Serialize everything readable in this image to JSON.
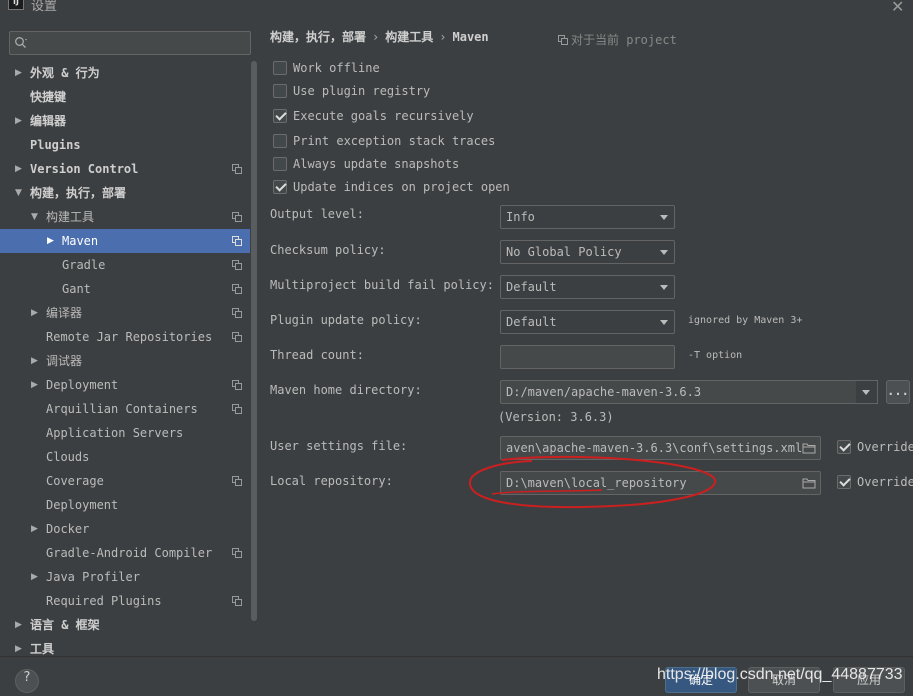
{
  "window": {
    "title": "设置",
    "app_icon_text": "IJ"
  },
  "sidebar": {
    "search": {
      "placeholder": "",
      "value": ""
    },
    "items": [
      {
        "label": "外观 & 行为",
        "arrow": "▶",
        "indent": 0,
        "bold": true,
        "copy": false,
        "selected": false
      },
      {
        "label": "快捷键",
        "arrow": "",
        "indent": 0,
        "bold": true,
        "copy": false,
        "selected": false
      },
      {
        "label": "编辑器",
        "arrow": "▶",
        "indent": 0,
        "bold": true,
        "copy": false,
        "selected": false
      },
      {
        "label": "Plugins",
        "arrow": "",
        "indent": 0,
        "bold": true,
        "copy": false,
        "selected": false
      },
      {
        "label": "Version Control",
        "arrow": "▶",
        "indent": 0,
        "bold": true,
        "copy": true,
        "selected": false
      },
      {
        "label": "构建，执行，部署",
        "arrow": "▼",
        "indent": 0,
        "bold": true,
        "copy": false,
        "selected": false
      },
      {
        "label": "构建工具",
        "arrow": "▼",
        "indent": 1,
        "bold": false,
        "copy": true,
        "selected": false
      },
      {
        "label": "Maven",
        "arrow": "▶",
        "indent": 2,
        "bold": false,
        "copy": true,
        "selected": true
      },
      {
        "label": "Gradle",
        "arrow": "",
        "indent": 2,
        "bold": false,
        "copy": true,
        "selected": false
      },
      {
        "label": "Gant",
        "arrow": "",
        "indent": 2,
        "bold": false,
        "copy": true,
        "selected": false
      },
      {
        "label": "编译器",
        "arrow": "▶",
        "indent": 1,
        "bold": false,
        "copy": true,
        "selected": false
      },
      {
        "label": "Remote Jar Repositories",
        "arrow": "",
        "indent": 1,
        "bold": false,
        "copy": true,
        "selected": false
      },
      {
        "label": "调试器",
        "arrow": "▶",
        "indent": 1,
        "bold": false,
        "copy": false,
        "selected": false
      },
      {
        "label": "Deployment",
        "arrow": "▶",
        "indent": 1,
        "bold": false,
        "copy": true,
        "selected": false
      },
      {
        "label": "Arquillian Containers",
        "arrow": "",
        "indent": 1,
        "bold": false,
        "copy": true,
        "selected": false
      },
      {
        "label": "Application Servers",
        "arrow": "",
        "indent": 1,
        "bold": false,
        "copy": false,
        "selected": false
      },
      {
        "label": "Clouds",
        "arrow": "",
        "indent": 1,
        "bold": false,
        "copy": false,
        "selected": false
      },
      {
        "label": "Coverage",
        "arrow": "",
        "indent": 1,
        "bold": false,
        "copy": true,
        "selected": false
      },
      {
        "label": "Deployment",
        "arrow": "",
        "indent": 1,
        "bold": false,
        "copy": false,
        "selected": false
      },
      {
        "label": "Docker",
        "arrow": "▶",
        "indent": 1,
        "bold": false,
        "copy": false,
        "selected": false
      },
      {
        "label": "Gradle-Android Compiler",
        "arrow": "",
        "indent": 1,
        "bold": false,
        "copy": true,
        "selected": false
      },
      {
        "label": "Java Profiler",
        "arrow": "▶",
        "indent": 1,
        "bold": false,
        "copy": false,
        "selected": false
      },
      {
        "label": "Required Plugins",
        "arrow": "",
        "indent": 1,
        "bold": false,
        "copy": true,
        "selected": false
      },
      {
        "label": "语言 & 框架",
        "arrow": "▶",
        "indent": 0,
        "bold": true,
        "copy": false,
        "selected": false
      },
      {
        "label": "工具",
        "arrow": "▶",
        "indent": 0,
        "bold": true,
        "copy": false,
        "selected": false
      }
    ]
  },
  "content": {
    "breadcrumb": [
      "构建，执行，部署",
      "构建工具",
      "Maven"
    ],
    "breadcrumb_sep": "›",
    "project_note": "对于当前 project",
    "checkboxes": [
      {
        "label": "Work offline",
        "checked": false
      },
      {
        "label": "Use plugin registry",
        "checked": false
      },
      {
        "label": "Execute goals recursively",
        "checked": true
      },
      {
        "label": "Print exception stack traces",
        "checked": false
      },
      {
        "label": "Always update snapshots",
        "checked": false
      },
      {
        "label": "Update indices on project open",
        "checked": true
      }
    ],
    "output_level": {
      "label": "Output level:",
      "value": "Info"
    },
    "checksum_policy": {
      "label": "Checksum policy:",
      "value": "No Global Policy"
    },
    "multiproject_policy": {
      "label": "Multiproject build fail policy:",
      "value": "Default"
    },
    "plugin_update_policy": {
      "label": "Plugin update policy:",
      "value": "Default",
      "hint": "ignored by Maven 3+"
    },
    "thread_count": {
      "label": "Thread count:",
      "value": "",
      "hint": "-T option"
    },
    "maven_home": {
      "label": "Maven home directory:",
      "value": "D:/maven/apache-maven-3.6.3",
      "version": "(Version: 3.6.3)",
      "ellipsis": "..."
    },
    "user_settings": {
      "label": "User settings file:",
      "value": "aven\\apache-maven-3.6.3\\conf\\settings.xml",
      "override_label": "Override",
      "override_checked": true
    },
    "local_repo": {
      "label": "Local repository:",
      "value": "D:\\maven\\local_repository",
      "override_label": "Override",
      "override_checked": true
    }
  },
  "footer": {
    "help": "?",
    "ok": "确定",
    "cancel": "取消",
    "apply": "应用",
    "watermark": "https://blog.csdn.net/qq_44887733"
  },
  "colors": {
    "background": "#3c3f41",
    "selection": "#4b6eaf",
    "annotation": "#cc1f1f",
    "primary_button": "#365880"
  }
}
